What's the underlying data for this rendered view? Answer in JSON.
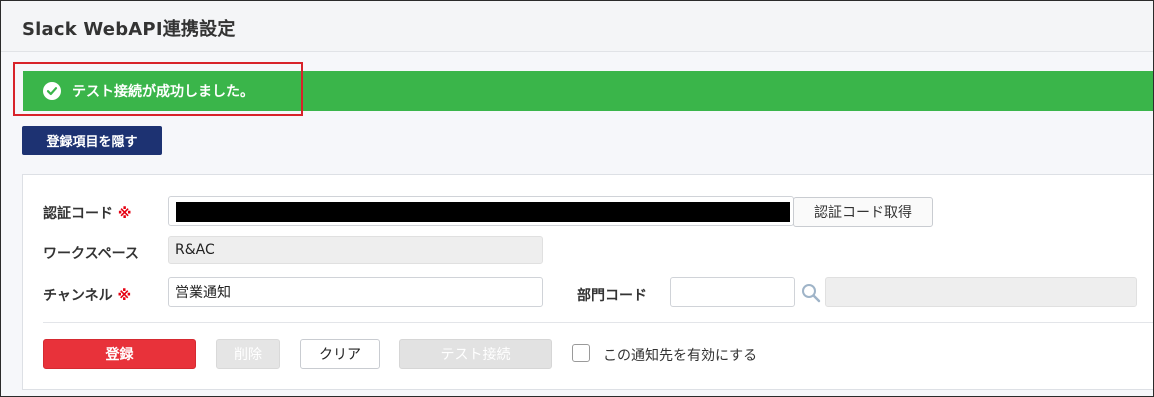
{
  "header": {
    "title": "Slack WebAPI連携設定"
  },
  "alert": {
    "message": "テスト接続が成功しました。",
    "color": "#3ab54a",
    "icon": "check-circle-icon"
  },
  "toggle_button": {
    "label": "登録項目を隠す"
  },
  "form": {
    "auth_code": {
      "label": "認証コード",
      "required_mark": "※",
      "value": "",
      "button_label": "認証コード取得"
    },
    "workspace": {
      "label": "ワークスペース",
      "value": "R&AC"
    },
    "channel": {
      "label": "チャンネル",
      "required_mark": "※",
      "value": "営業通知"
    },
    "department": {
      "label": "部門コード",
      "value": "",
      "name_value": "",
      "search_icon": "search-icon"
    }
  },
  "actions": {
    "register": "登録",
    "delete": "削除",
    "clear": "クリア",
    "test_connection": "テスト接続",
    "enable_label": "この通知先を有効にする",
    "enable_checked": false
  }
}
